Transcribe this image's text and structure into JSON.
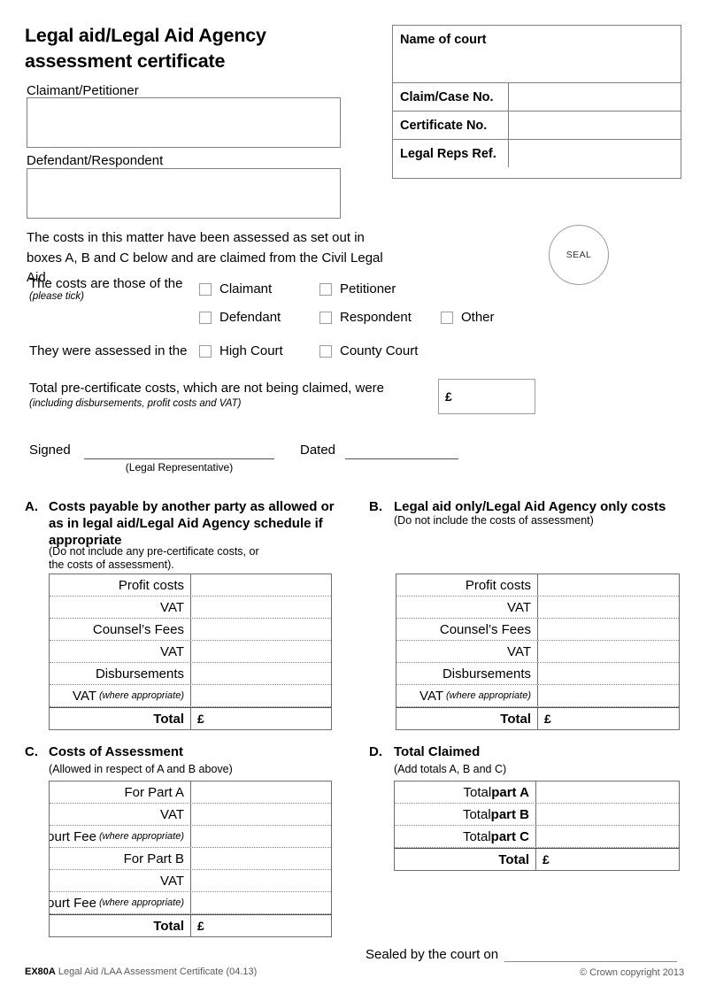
{
  "form": {
    "title_line1": "Legal aid/Legal Aid Agency",
    "title_line2": "assessment certificate"
  },
  "parties": {
    "claimant_label": "Claimant/Petitioner",
    "defendant_label": "Defendant/Respondent",
    "claimant_value": "",
    "defendant_value": ""
  },
  "court_details": {
    "name_of_court_label": "Name of court",
    "name_of_court_value": "",
    "rows": [
      {
        "label": "Claim/Case No.",
        "value": ""
      },
      {
        "label": "Certificate No.",
        "value": ""
      },
      {
        "label": "Legal Reps Ref.",
        "value": ""
      }
    ]
  },
  "statement": {
    "line1": "The costs in this matter have been assessed as set out in",
    "line2": "boxes A, B and C below and are claimed from the Civil Legal Aid."
  },
  "seal": {
    "label": "SEAL"
  },
  "costs_of": {
    "label": "The costs are those of the",
    "sub_label": "(please tick)",
    "row1": [
      {
        "name": "claimant",
        "label": "Claimant",
        "checked": false
      },
      {
        "name": "petitioner",
        "label": "Petitioner",
        "checked": false
      }
    ],
    "row2": [
      {
        "name": "defendant",
        "label": "Defendant",
        "checked": false
      },
      {
        "name": "respondent",
        "label": "Respondent",
        "checked": false
      },
      {
        "name": "other",
        "label": "Other",
        "checked": false
      }
    ]
  },
  "assessed_in": {
    "label": "They were assessed in the",
    "options": [
      {
        "name": "high-court",
        "label": "High Court",
        "checked": false
      },
      {
        "name": "county-court",
        "label": "County Court",
        "checked": false
      }
    ]
  },
  "pre_certificate": {
    "text": "Total pre-certificate costs, which are not being claimed, were",
    "sub_text": "(including disbursements, profit costs and VAT)",
    "currency": "£",
    "value": ""
  },
  "signature": {
    "signed_label": "Signed",
    "signed_value": "",
    "legal_rep_caption": "(Legal Representative)",
    "dated_label": "Dated",
    "dated_value": ""
  },
  "sections": {
    "a": {
      "letter": "A.",
      "title": "Costs payable by another party as allowed or as in legal aid/Legal Aid Agency schedule if appropriate",
      "note_line1": "(Do not include any pre-certificate costs, or",
      "note_line2": "the costs of assessment).",
      "rows": [
        {
          "label": "Profit costs",
          "paren": "",
          "value": ""
        },
        {
          "label": "VAT",
          "paren": "",
          "value": ""
        },
        {
          "label": "Counsel’s Fees",
          "paren": "",
          "value": ""
        },
        {
          "label": "VAT",
          "paren": "",
          "value": ""
        },
        {
          "label": "Disbursements",
          "paren": "",
          "value": ""
        },
        {
          "label": "VAT",
          "paren": "(where appropriate)",
          "value": ""
        }
      ],
      "total_label": "Total",
      "total_currency": "£",
      "total_value": ""
    },
    "b": {
      "letter": "B.",
      "title": "Legal aid only/Legal Aid Agency only costs",
      "note_line1": "(Do not include the costs of assessment)",
      "note_line2": "",
      "rows": [
        {
          "label": "Profit costs",
          "paren": "",
          "value": ""
        },
        {
          "label": "VAT",
          "paren": "",
          "value": ""
        },
        {
          "label": "Counsel’s Fees",
          "paren": "",
          "value": ""
        },
        {
          "label": "VAT",
          "paren": "",
          "value": ""
        },
        {
          "label": "Disbursements",
          "paren": "",
          "value": ""
        },
        {
          "label": "VAT",
          "paren": "(where appropriate)",
          "value": ""
        }
      ],
      "total_label": "Total",
      "total_currency": "£",
      "total_value": ""
    },
    "c": {
      "letter": "C.",
      "title": "Costs of Assessment",
      "note_line1": "(Allowed in respect of A and B above)",
      "rows": [
        {
          "label": "For Part A",
          "paren": "",
          "value": ""
        },
        {
          "label": "VAT",
          "paren": "",
          "value": ""
        },
        {
          "label": "Court Fee",
          "paren": "(where appropriate)",
          "value": ""
        },
        {
          "label": "For Part B",
          "paren": "",
          "value": ""
        },
        {
          "label": "VAT",
          "paren": "",
          "value": ""
        },
        {
          "label": "Court Fee",
          "paren": "(where appropriate)",
          "value": ""
        }
      ],
      "total_label": "Total",
      "total_currency": "£",
      "total_value": ""
    },
    "d": {
      "letter": "D.",
      "title": "Total Claimed",
      "note_line1": "(Add totals A, B and C)",
      "rows": [
        {
          "label": "Total ",
          "bold_part": "part A",
          "value": ""
        },
        {
          "label": "Total ",
          "bold_part": "part B",
          "value": ""
        },
        {
          "label": "Total ",
          "bold_part": "part C",
          "value": ""
        }
      ],
      "total_label": "Total",
      "total_currency": "£",
      "total_value": ""
    }
  },
  "sealed_by": {
    "label": "Sealed by the court on",
    "value": ""
  },
  "footer": {
    "code": "EX80A",
    "description": " Legal Aid /LAA Assessment Certificate (04.13)",
    "copyright": "© Crown copyright 2013"
  },
  "colors": {
    "border_grey": "#808080",
    "border_dark": "#6e6e6e",
    "text": "#000000",
    "muted": "#5a5a5a"
  }
}
